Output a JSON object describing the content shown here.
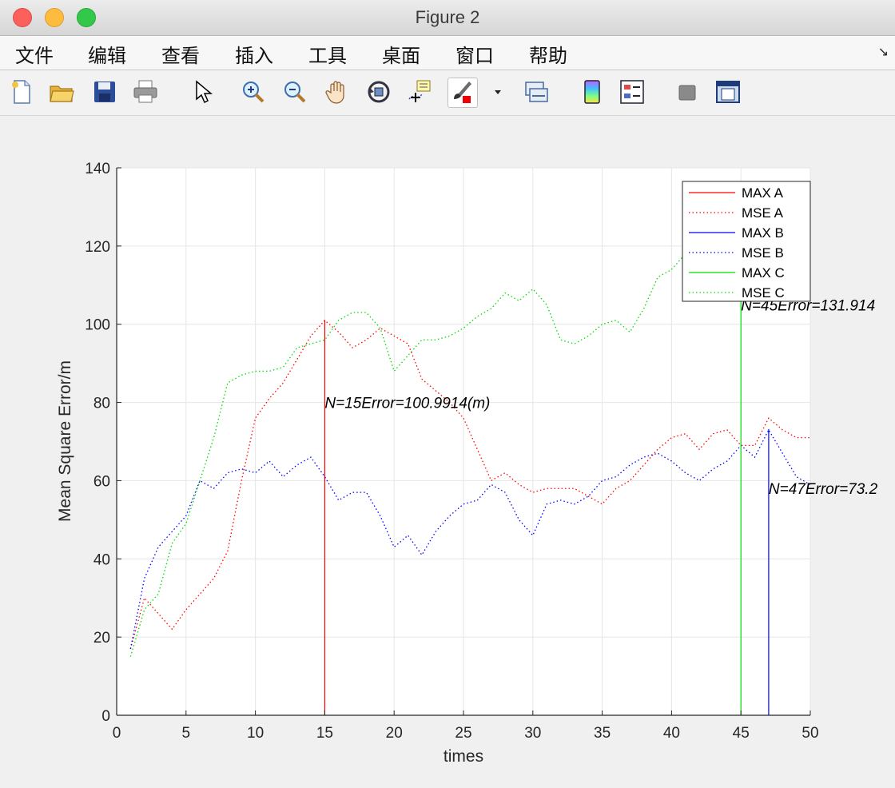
{
  "window": {
    "title": "Figure 2"
  },
  "menu": {
    "items": [
      "文件",
      "编辑",
      "查看",
      "插入",
      "工具",
      "桌面",
      "窗口",
      "帮助"
    ],
    "corner_glyph": "↘"
  },
  "toolbar": {
    "icons": [
      "new-file-icon",
      "open-folder-icon",
      "save-icon",
      "print-icon",
      "pointer-icon",
      "zoom-in-icon",
      "zoom-out-icon",
      "pan-hand-icon",
      "rotate-3d-icon",
      "data-cursor-icon",
      "brush-icon",
      "dropdown-arrow-icon",
      "link-plot-icon",
      "colorbar-icon",
      "legend-icon",
      "hide-plot-tools-icon",
      "show-plot-tools-icon"
    ]
  },
  "chart_data": {
    "type": "line",
    "xlabel": "times",
    "ylabel": "Mean Square Error/m",
    "xlim": [
      0,
      50
    ],
    "ylim": [
      0,
      140
    ],
    "xticks": [
      0,
      5,
      10,
      15,
      20,
      25,
      30,
      35,
      40,
      45,
      50
    ],
    "yticks": [
      0,
      20,
      40,
      60,
      80,
      100,
      120,
      140
    ],
    "grid": true,
    "legend_position": "top-right",
    "x": [
      1,
      2,
      3,
      4,
      5,
      6,
      7,
      8,
      9,
      10,
      11,
      12,
      13,
      14,
      15,
      16,
      17,
      18,
      19,
      20,
      21,
      22,
      23,
      24,
      25,
      26,
      27,
      28,
      29,
      30,
      31,
      32,
      33,
      34,
      35,
      36,
      37,
      38,
      39,
      40,
      41,
      42,
      43,
      44,
      45,
      46,
      47,
      48,
      49,
      50
    ],
    "series": [
      {
        "name": "MAX A",
        "style": "solid",
        "color": "#ff0000",
        "stem_x": 15,
        "stem_y": 100.9914
      },
      {
        "name": "MSE A",
        "style": "dotted",
        "color": "#ff0000",
        "values": [
          17,
          30,
          26,
          22,
          27,
          31,
          35,
          42,
          60,
          76,
          81,
          85,
          91,
          97,
          101,
          98,
          94,
          96,
          99,
          97,
          95,
          86,
          83,
          80,
          76,
          68,
          60,
          62,
          59,
          57,
          58,
          58,
          58,
          56,
          54,
          58,
          60,
          64,
          68,
          71,
          72,
          68,
          72,
          73,
          69,
          69,
          76,
          73,
          71,
          71
        ]
      },
      {
        "name": "MAX B",
        "style": "solid",
        "color": "#0000ff",
        "stem_x": 47,
        "stem_y": 73.2
      },
      {
        "name": "MSE B",
        "style": "dotted",
        "color": "#0000ff",
        "values": [
          17,
          35,
          43,
          47,
          51,
          60,
          58,
          62,
          63,
          62,
          65,
          61,
          64,
          66,
          61,
          55,
          57,
          57,
          51,
          43,
          46,
          41,
          47,
          51,
          54,
          55,
          59,
          57,
          50,
          46,
          54,
          55,
          54,
          56,
          60,
          61,
          64,
          66,
          67,
          65,
          62,
          60,
          63,
          65,
          69,
          66,
          73,
          67,
          61,
          59
        ]
      },
      {
        "name": "MAX C",
        "style": "solid",
        "color": "#00dd00",
        "stem_x": 45,
        "stem_y": 131.914
      },
      {
        "name": "MSE C",
        "style": "dotted",
        "color": "#00dd00",
        "values": [
          15,
          27,
          31,
          44,
          49,
          60,
          71,
          85,
          87,
          88,
          88,
          89,
          94,
          95,
          96,
          101,
          103,
          103,
          99,
          88,
          92,
          96,
          96,
          97,
          99,
          102,
          104,
          108,
          106,
          109,
          105,
          96,
          95,
          97,
          100,
          101,
          98,
          104,
          112,
          114,
          118,
          121,
          120,
          119,
          116,
          120,
          119,
          118,
          120,
          117
        ]
      }
    ],
    "annotations": [
      {
        "text": "N=15Error=100.9914(m)",
        "x": 15,
        "y": 80
      },
      {
        "text": "N=47Error=73.2",
        "x": 47,
        "y": 58
      },
      {
        "text": "N=45Error=131.914",
        "x": 45,
        "y": 105
      }
    ]
  }
}
